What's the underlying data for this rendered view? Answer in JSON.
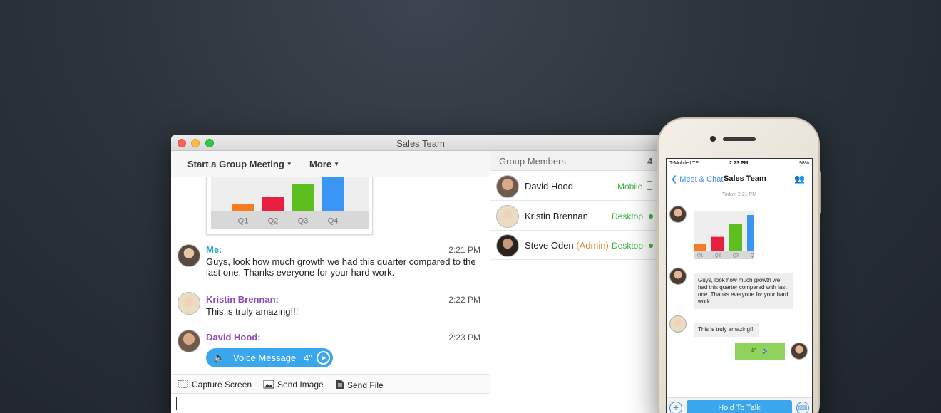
{
  "window": {
    "title": "Sales Team"
  },
  "toolbar": {
    "meeting_label": "Start a Group Meeting",
    "more_label": "More"
  },
  "chart_data": {
    "type": "bar",
    "categories": [
      "Q1",
      "Q2",
      "Q3",
      "Q4"
    ],
    "values": [
      1,
      2,
      3.8,
      5
    ],
    "colors": [
      "#f47b20",
      "#e8203f",
      "#5cbf1e",
      "#3a95f5"
    ]
  },
  "messages": [
    {
      "sender": "Me:",
      "time": "2:21 PM",
      "text": "Guys, look how much growth we had this quarter compared to the last one. Thanks everyone for your hard work.",
      "color": "#2aa8c8"
    },
    {
      "sender": "Kristin Brennan:",
      "time": "2:22 PM",
      "text": "This is truly amazing!!!",
      "color": "#8e4bb5"
    },
    {
      "sender": "David Hood:",
      "time": "2:23 PM",
      "voice_label": "Voice Message",
      "voice_duration": "4\"",
      "color": "#8e4bb5"
    }
  ],
  "actions": {
    "capture": "Capture Screen",
    "image": "Send Image",
    "file": "Send File"
  },
  "members": {
    "title": "Group Members",
    "count": "4",
    "list": [
      {
        "name": "David Hood",
        "admin": "",
        "status": "Mobile"
      },
      {
        "name": "Kristin Brennan",
        "admin": "",
        "status": "Desktop"
      },
      {
        "name": "Steve Oden",
        "admin": "(Admin)",
        "status": "Desktop"
      }
    ]
  },
  "phone": {
    "carrier": "T-Mobile  LTE",
    "clock": "2:23 PM",
    "battery": "98%",
    "back_label": "Meet & Chat",
    "nav_title": "Sales Team",
    "today": "Today, 2:21 PM",
    "msg1": "Guys, look how much growth we had this quarter compared with last one. Thanks everyone for your hard work",
    "msg2": "This is truly amazing!!!",
    "voice_duration": "4\"",
    "hold_label": "Hold To Talk"
  }
}
